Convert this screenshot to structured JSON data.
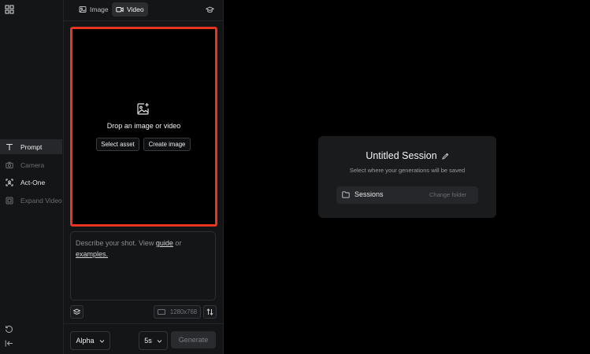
{
  "rail": {
    "items": [
      {
        "label": "Prompt",
        "icon": "text-t-icon",
        "state": "active"
      },
      {
        "label": "Camera",
        "icon": "camera-icon",
        "state": "disabled"
      },
      {
        "label": "Act-One",
        "icon": "act-one-icon",
        "state": "enabled"
      },
      {
        "label": "Expand Video",
        "icon": "expand-video-icon",
        "state": "disabled"
      }
    ]
  },
  "panel": {
    "tabs": [
      {
        "label": "Image",
        "icon": "image-icon",
        "active": false
      },
      {
        "label": "Video",
        "icon": "video-camera-icon",
        "active": true
      }
    ],
    "dropzone": {
      "text": "Drop an image or video",
      "select_asset": "Select asset",
      "create_image": "Create image",
      "highlight_color": "#e8351f"
    },
    "prompt": {
      "placeholder_before": "Describe your shot. View ",
      "guide_link": "guide",
      "placeholder_mid": " or",
      "examples_link": "examples."
    },
    "resolution": "1280x768",
    "model": "Alpha",
    "duration": "5s",
    "generate": "Generate"
  },
  "session": {
    "title": "Untitled Session",
    "subtitle": "Select where your generations will be saved",
    "folder_name": "Sessions",
    "change_folder": "Change folder"
  }
}
